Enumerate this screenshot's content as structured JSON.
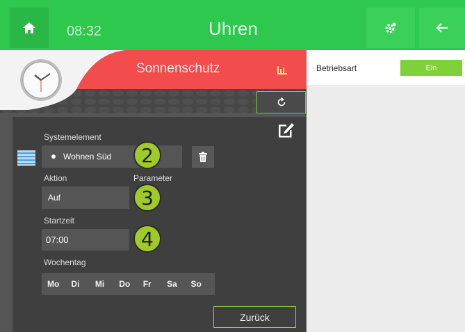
{
  "topbar": {
    "time": "08:32",
    "title": "Uhren",
    "home_icon": "home-icon",
    "settings_icon": "gear-icon",
    "back_icon": "arrow-left-icon",
    "color": "#2dc84d"
  },
  "panel": {
    "header": "Sonnenschutz",
    "header_color": "#f24c4c",
    "chart_icon": "bar-chart-icon",
    "clock_icon": "clock-icon",
    "reset_icon": "reset-icon",
    "edit_icon": "edit-icon"
  },
  "form": {
    "systemelement_label": "Systemelement",
    "systemelement_value": "Wohnen Süd",
    "blind_icon": "blind-icon",
    "trash_icon": "trash-icon",
    "aktion_label": "Aktion",
    "parameter_label": "Parameter",
    "aktion_value": "Auf",
    "startzeit_label": "Startzeit",
    "startzeit_value": "07:00",
    "wochentag_label": "Wochentag",
    "weekdays": [
      "Mo",
      "Di",
      "Mi",
      "Do",
      "Fr",
      "Sa",
      "So"
    ],
    "back_button": "Zurück"
  },
  "callouts": [
    "2",
    "3",
    "4"
  ],
  "right": {
    "betriebsart_label": "Betriebsart",
    "ein_button": "Ein",
    "ein_color": "#7ed138"
  }
}
